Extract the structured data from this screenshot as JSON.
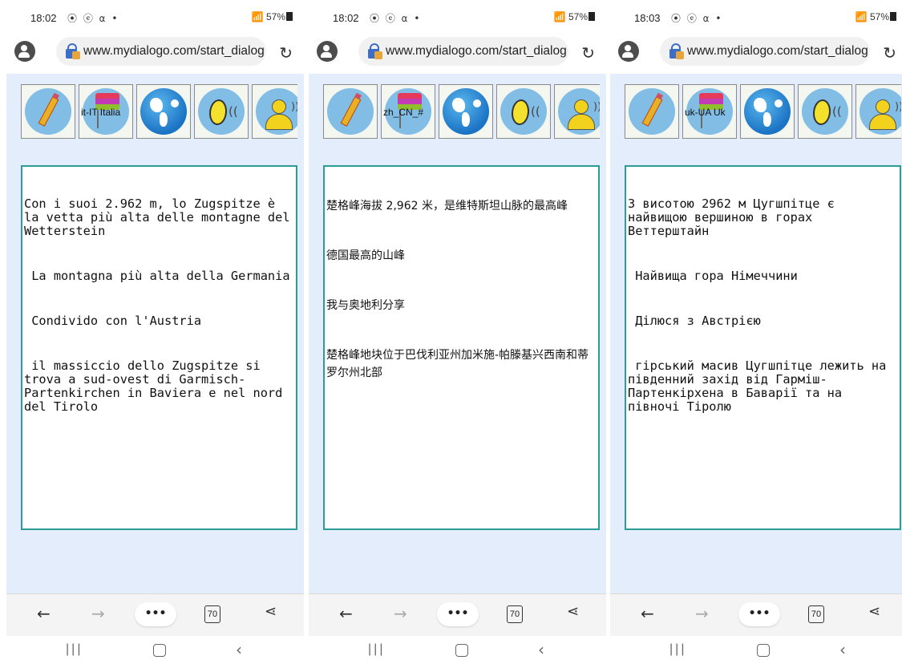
{
  "browser": {
    "url": "www.mydialogo.com/start_dialog",
    "tab_count": "70",
    "more_label": "•••"
  },
  "status_icons": "⦿ ⓔ ⍺ •",
  "screens": [
    {
      "time": "18:02",
      "battery": "57%",
      "lang_label": "it-IT Italia",
      "paragraphs": [
        "Con i suoi 2.962 m, lo Zugspitze è la vetta più alta delle montagne del Wetterstein",
        " La montagna più alta della Germania",
        " Condivido con l'Austria",
        " il massiccio dello Zugspitze si trova a sud-ovest di Garmisch-Partenkirchen in Baviera e nel nord del Tirolo"
      ]
    },
    {
      "time": "18:02",
      "battery": "57%",
      "lang_label": "zh_CN_#",
      "paragraphs": [
        "楚格峰海拔 2,962 米，是维特斯坦山脉的最高峰",
        "德国最高的山峰",
        "我与奥地利分享",
        "楚格峰地块位于巴伐利亚州加米施-帕滕基兴西南和蒂罗尔州北部"
      ]
    },
    {
      "time": "18:03",
      "battery": "57%",
      "lang_label": "uk-UA Uk",
      "paragraphs": [
        "З висотою 2962 м Цугшпітце є найвищою вершиною в горах Веттерштайн",
        " Найвища гора Німеччини",
        " Ділюся з Австрією",
        " гірський масив Цугшпітце лежить на південний захід від Гарміш-Партенкірхена в Баварії та на півночі Тіролю"
      ]
    }
  ]
}
